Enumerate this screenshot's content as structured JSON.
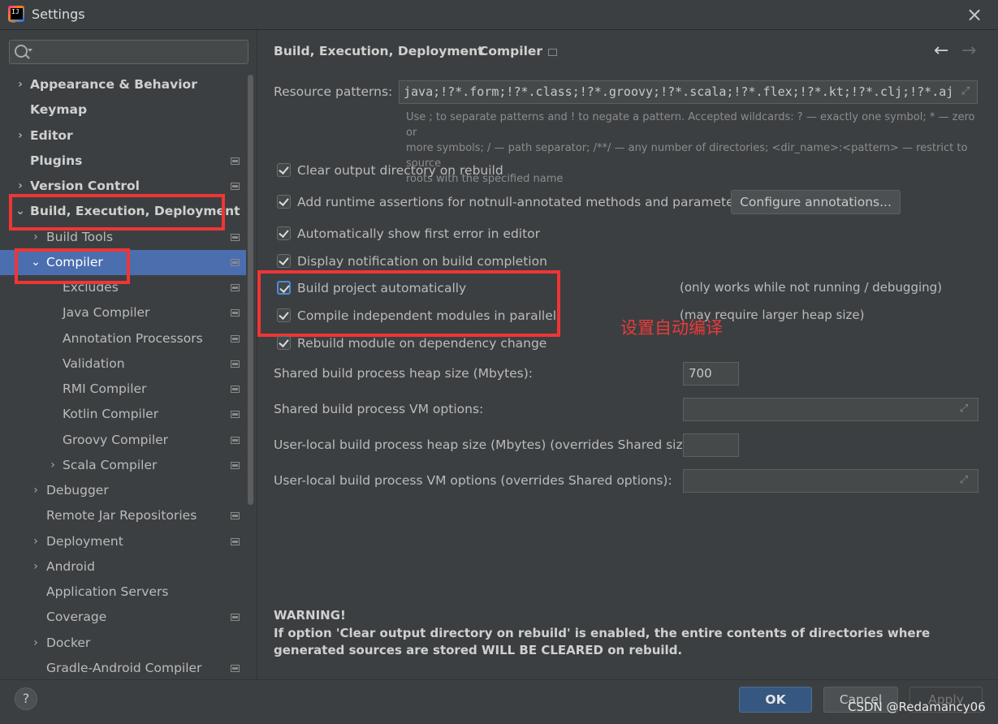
{
  "window": {
    "title": "Settings",
    "icon": "intellij-idea-icon",
    "close": "×"
  },
  "search": {
    "placeholder": ""
  },
  "sidebar": {
    "items": [
      {
        "label": "Appearance & Behavior",
        "chevron": "›"
      },
      {
        "label": "Keymap"
      },
      {
        "label": "Editor",
        "chevron": "›"
      },
      {
        "label": "Plugins"
      },
      {
        "label": "Version Control",
        "chevron": "›"
      },
      {
        "label": "Build, Execution, Deployment",
        "chevron": "⌄"
      },
      {
        "label": "Build Tools",
        "chevron": "›"
      },
      {
        "label": "Compiler",
        "chevron": "⌄"
      },
      {
        "label": "Excludes"
      },
      {
        "label": "Java Compiler"
      },
      {
        "label": "Annotation Processors"
      },
      {
        "label": "Validation"
      },
      {
        "label": "RMI Compiler"
      },
      {
        "label": "Kotlin Compiler"
      },
      {
        "label": "Groovy Compiler"
      },
      {
        "label": "Scala Compiler",
        "chevron": "›"
      },
      {
        "label": "Debugger",
        "chevron": "›"
      },
      {
        "label": "Remote Jar Repositories"
      },
      {
        "label": "Deployment",
        "chevron": "›"
      },
      {
        "label": "Android",
        "chevron": "›"
      },
      {
        "label": "Application Servers"
      },
      {
        "label": "Coverage"
      },
      {
        "label": "Docker",
        "chevron": "›"
      },
      {
        "label": "Gradle-Android Compiler"
      }
    ]
  },
  "breadcrumb": {
    "parent": "Build, Execution, Deployment",
    "separator": "›",
    "current": "Compiler"
  },
  "nav": {
    "back": "←",
    "forward": "→"
  },
  "resource_patterns": {
    "label": "Resource patterns:",
    "value": "java;!?*.form;!?*.class;!?*.groovy;!?*.scala;!?*.flex;!?*.kt;!?*.clj;!?*.aj",
    "hint_1": "Use ; to separate patterns and ! to negate a pattern. Accepted wildcards: ? — exactly one symbol; * — zero or",
    "hint_2": "more symbols; / — path separator; /**/ — any number of directories; <dir_name>:<pattern> — restrict to source",
    "hint_3": "roots with the specified name"
  },
  "options": {
    "clear_output": "Clear output directory on rebuild",
    "runtime_assertions": "Add runtime assertions for notnull-annotated methods and parameters",
    "configure_annotations": "Configure annotations...",
    "show_first_error": "Automatically show first error in editor",
    "display_notification": "Display notification on build completion",
    "build_auto": "Build project automatically",
    "build_auto_note": "(only works while not running / debugging)",
    "parallel": "Compile independent modules in parallel",
    "parallel_note": "(may require larger heap size)",
    "rebuild_dependency": "Rebuild module on dependency change"
  },
  "annotation": {
    "text": "设置自动编译",
    "color": "#ea3a3a"
  },
  "fields": {
    "shared_heap_label": "Shared build process heap size (Mbytes):",
    "shared_heap_value": "700",
    "shared_vm_label": "Shared build process VM options:",
    "shared_vm_value": "",
    "local_heap_label": "User-local build process heap size (Mbytes) (overrides Shared size):",
    "local_heap_value": "",
    "local_vm_label": "User-local build process VM options (overrides Shared options):",
    "local_vm_value": ""
  },
  "warning": {
    "title": "WARNING!",
    "body": "If option 'Clear output directory on rebuild' is enabled, the entire contents of directories where generated sources are stored WILL BE CLEARED on rebuild."
  },
  "buttons": {
    "help": "?",
    "ok": "OK",
    "cancel": "Cancel",
    "apply": "Apply"
  },
  "watermark": "CSDN @Redamancy06",
  "colors": {
    "selection": "#4b6eaf",
    "highlight_box": "#f03535",
    "ok_button": "#365880"
  }
}
